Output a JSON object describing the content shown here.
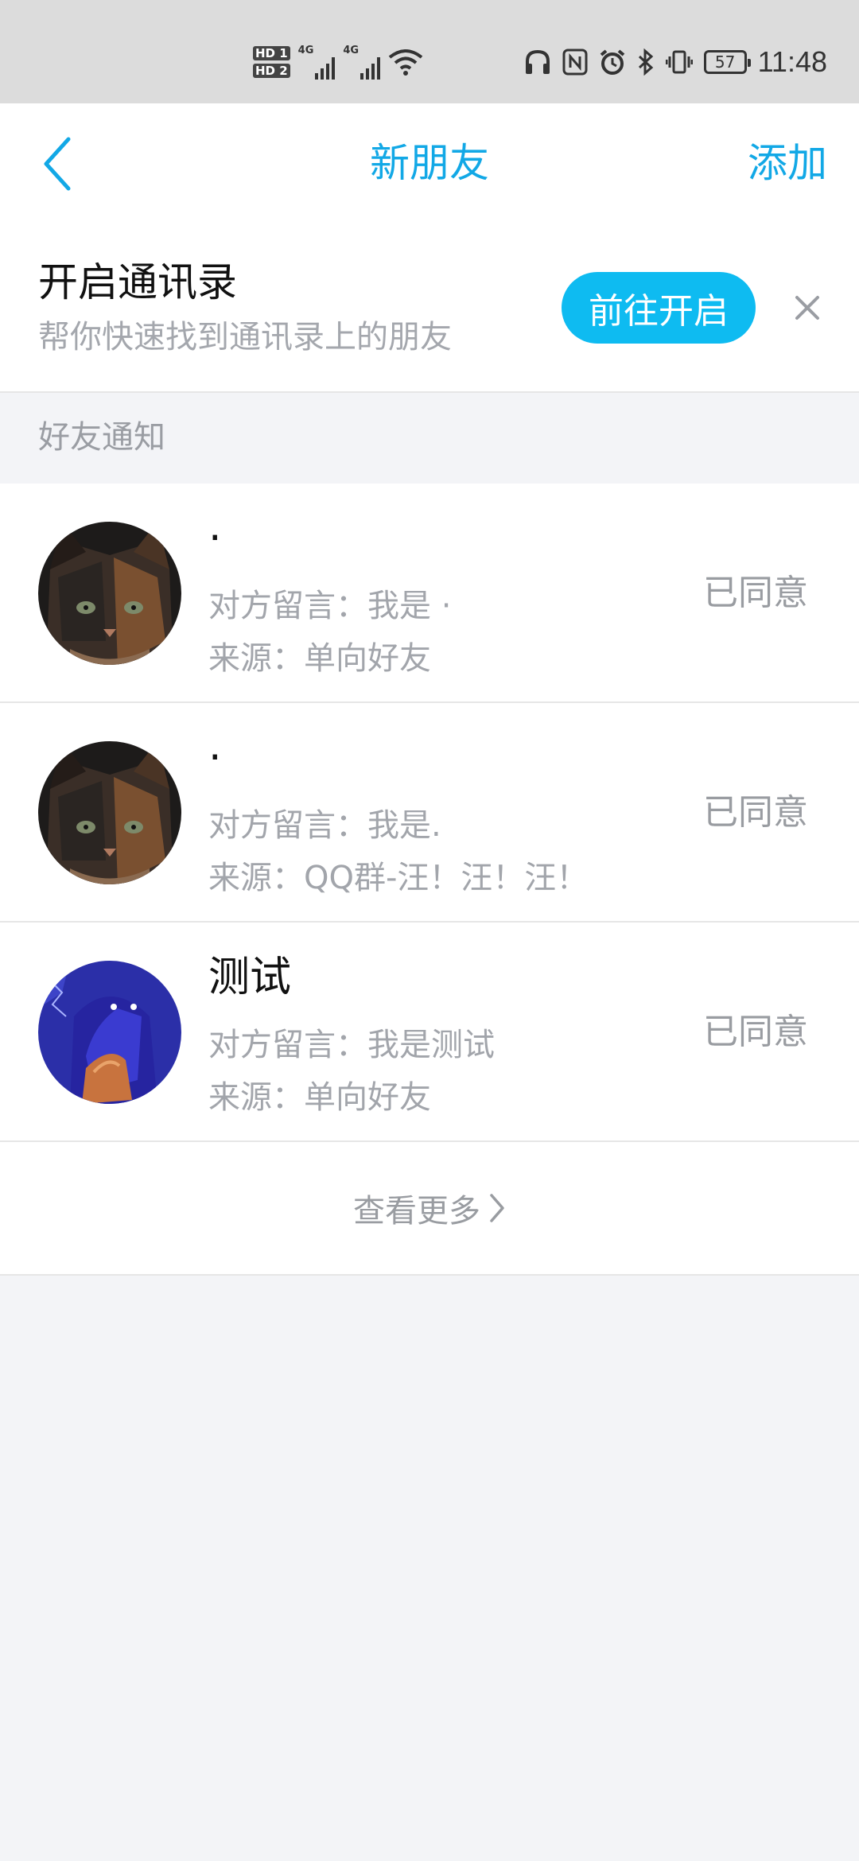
{
  "status_bar": {
    "hd1": "HD 1",
    "hd2": "HD 2",
    "net1": "4G",
    "net2": "4G",
    "battery": "57",
    "time": "11:48",
    "icons": [
      "headphones-icon",
      "nfc-icon",
      "alarm-icon",
      "bluetooth-icon",
      "vibrate-icon",
      "battery-icon"
    ]
  },
  "header": {
    "back_icon": "chevron-left-icon",
    "title": "新朋友",
    "add_label": "添加",
    "accent": "#12a8e6"
  },
  "banner": {
    "title": "开启通讯录",
    "subtitle": "帮你快速找到通讯录上的朋友",
    "button": "前往开启",
    "close_icon": "close-icon",
    "button_color": "#0ebbf1"
  },
  "section": {
    "label": "好友通知"
  },
  "friends": [
    {
      "name": "·",
      "message": "对方留言：我是 ·",
      "source": "来源：单向好友",
      "status": "已同意",
      "avatar": "cat-avatar"
    },
    {
      "name": "·",
      "message": "对方留言：我是.",
      "source": "来源：QQ群-汪！汪！汪！",
      "status": "已同意",
      "avatar": "cat-avatar"
    },
    {
      "name": "测试",
      "message": "对方留言：我是测试",
      "source": "来源：单向好友",
      "status": "已同意",
      "avatar": "blue-figure-avatar"
    }
  ],
  "more": {
    "label": "查看更多",
    "icon": "chevron-right-icon"
  }
}
